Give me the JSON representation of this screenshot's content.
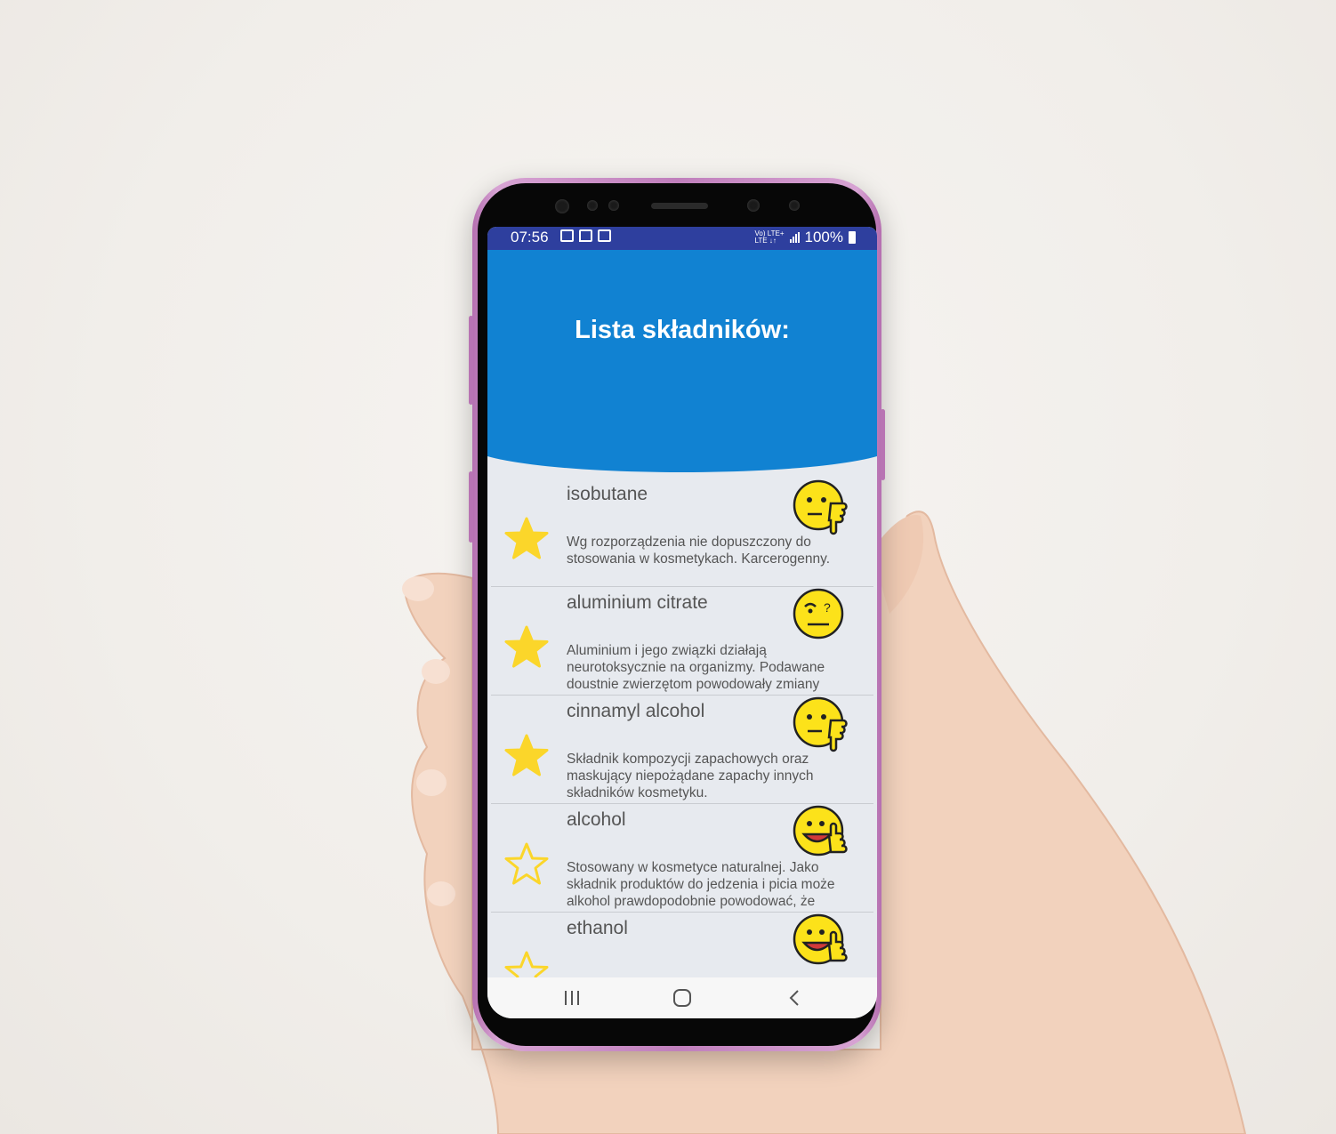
{
  "status_bar": {
    "time": "07:56",
    "network_top": "Vo) LTE+",
    "network_bottom": "LTE ↓↑",
    "battery": "100%"
  },
  "header": {
    "title": "Lista składników:"
  },
  "ingredients": [
    {
      "name": "isobutane",
      "description": "Wg rozporządzenia nie dopuszczony do stosowania w kosmetykach. Karcerogenny.",
      "favorite": true,
      "rating_icon": "thumbs-down-face-icon"
    },
    {
      "name": "aluminium citrate",
      "description": "Aluminium i jego związki działają neurotoksycznie na organizmy. Podawane doustnie zwierzętom powodowały zmiany",
      "favorite": true,
      "rating_icon": "confused-face-icon"
    },
    {
      "name": "cinnamyl alcohol",
      "description": "Składnik kompozycji zapachowych oraz maskujący niepożądane zapachy innych składników kosmetyku.",
      "favorite": true,
      "rating_icon": "thumbs-down-face-icon"
    },
    {
      "name": "alcohol",
      "description": "Stosowany w kosmetyce naturalnej. Jako składnik produktów do jedzenia i picia może alkohol prawdopodobnie powodować, że",
      "favorite": false,
      "rating_icon": "thumbs-up-face-icon"
    },
    {
      "name": "ethanol",
      "description": "",
      "favorite": false,
      "rating_icon": "thumbs-up-face-icon"
    }
  ],
  "colors": {
    "header": "#1182d2",
    "status_bar": "#2e3f9e",
    "star": "#fbd62a",
    "emoji": "#fce21a"
  }
}
